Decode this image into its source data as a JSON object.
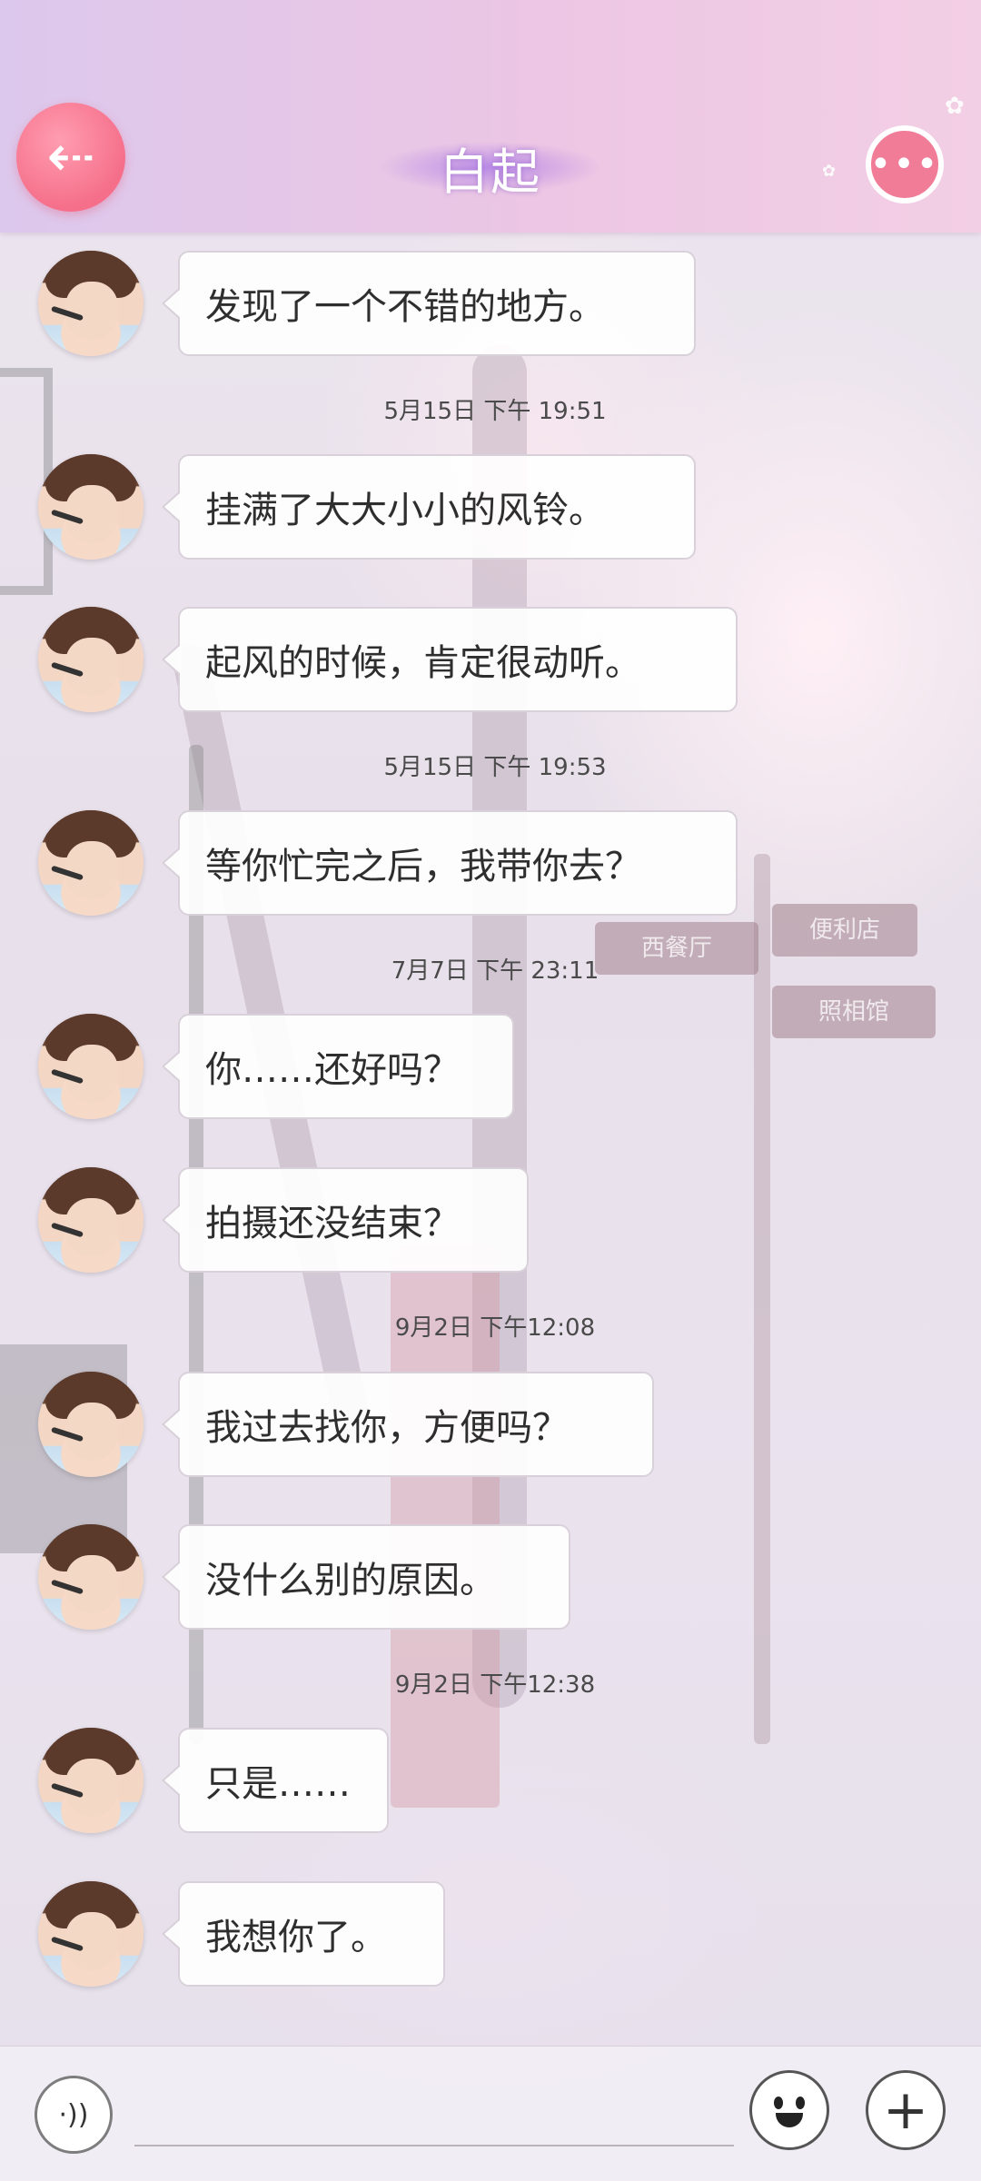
{
  "header": {
    "title": "白起",
    "back_icon": "arrow-left-icon",
    "more_icon": "more-dots-icon"
  },
  "messages": [
    {
      "text": "发现了一个不错的地方。"
    },
    {
      "timestamp": "5月15日  下午 19:51"
    },
    {
      "text": "挂满了大大小小的风铃。"
    },
    {
      "text": "起风的时候，肯定很动听。"
    },
    {
      "timestamp": "5月15日  下午 19:53"
    },
    {
      "text": "等你忙完之后，我带你去？"
    },
    {
      "timestamp": "7月7日  下午 23:11"
    },
    {
      "text": "你……还好吗？"
    },
    {
      "text": "拍摄还没结束？"
    },
    {
      "timestamp": "9月2日  下午12:08"
    },
    {
      "text": "我过去找你，方便吗？"
    },
    {
      "text": "没什么别的原因。"
    },
    {
      "timestamp": "9月2日  下午12:38"
    },
    {
      "text": "只是……"
    },
    {
      "text": "我想你了。"
    }
  ],
  "scene_signs": [
    "西餐厅",
    "便利店",
    "照相馆"
  ],
  "footer": {
    "voice_icon": "voice-icon",
    "emoji_icon": "emoji-icon",
    "plus_icon": "plus-icon"
  },
  "colors": {
    "accent_pink": "#f07c97",
    "header_gradient_start": "#dcc8ec",
    "header_gradient_end": "#f3cfe5"
  }
}
